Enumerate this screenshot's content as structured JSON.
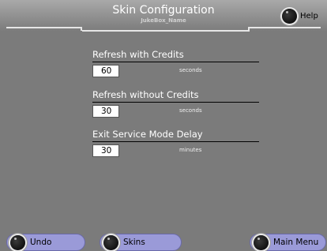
{
  "header": {
    "title": "Skin Configuration",
    "subtitle": "JukeBox_Name",
    "help_label": "Help"
  },
  "settings": [
    {
      "label": "Refresh with Credits",
      "value": "60",
      "unit": "seconds"
    },
    {
      "label": "Refresh without Credits",
      "value": "30",
      "unit": "seconds"
    },
    {
      "label": "Exit Service Mode Delay",
      "value": "30",
      "unit": "minutes"
    }
  ],
  "footer": {
    "undo_label": "Undo",
    "skins_label": "Skins",
    "main_menu_label": "Main Menu"
  },
  "colors": {
    "background": "#7b7b7b",
    "button_fill": "#9a9ad8",
    "text_light": "#ffffff"
  },
  "icons": {
    "knob": "knob-icon"
  }
}
